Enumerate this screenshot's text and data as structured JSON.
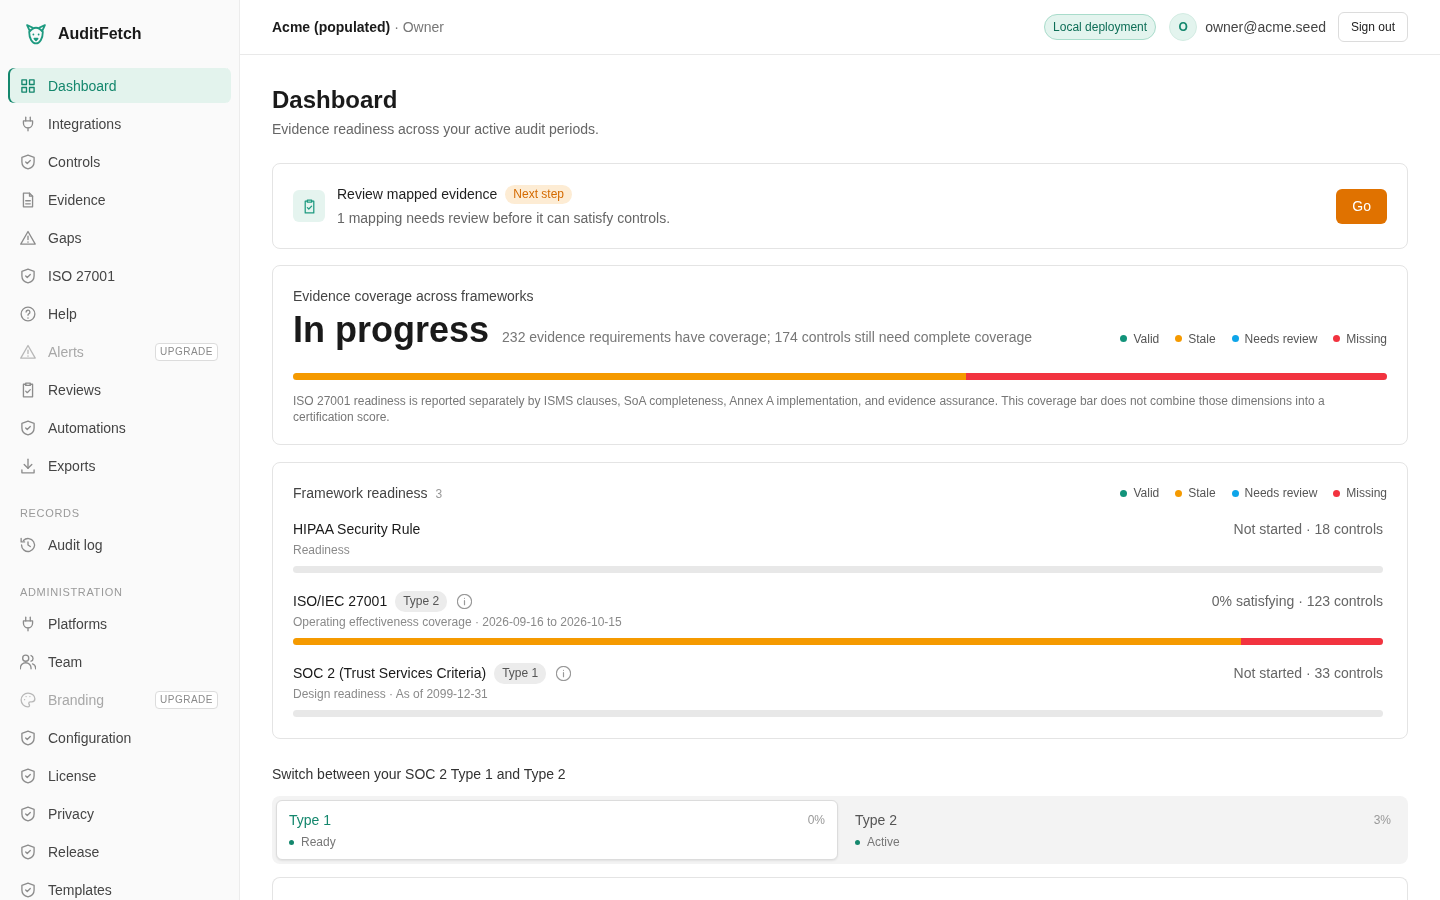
{
  "sidebar": {
    "brand": "AuditFetch",
    "sections": [
      {
        "items": [
          {
            "label": "Dashboard",
            "selected": true,
            "disabled": false
          },
          {
            "label": "Integrations",
            "selected": false,
            "disabled": false
          },
          {
            "label": "Controls",
            "selected": false,
            "disabled": false
          },
          {
            "label": "Evidence",
            "selected": false,
            "disabled": false
          },
          {
            "label": "Gaps",
            "selected": false,
            "disabled": false
          },
          {
            "label": "ISO 27001",
            "selected": false,
            "disabled": false
          },
          {
            "label": "Help",
            "selected": false,
            "disabled": false
          },
          {
            "label": "Alerts",
            "selected": false,
            "disabled": true,
            "badge": "UPGRADE"
          },
          {
            "label": "Reviews",
            "selected": false,
            "disabled": false
          },
          {
            "label": "Automations",
            "selected": false,
            "disabled": false
          },
          {
            "label": "Exports",
            "selected": false,
            "disabled": false
          }
        ]
      },
      {
        "label": "RECORDS",
        "items": [
          {
            "label": "Audit log",
            "selected": false,
            "disabled": false
          }
        ]
      },
      {
        "label": "ADMINISTRATION",
        "items": [
          {
            "label": "Platforms",
            "selected": false,
            "disabled": false
          },
          {
            "label": "Team",
            "selected": false,
            "disabled": false
          },
          {
            "label": "Branding",
            "selected": false,
            "disabled": true,
            "badge": "UPGRADE"
          },
          {
            "label": "Configuration",
            "selected": false,
            "disabled": false
          },
          {
            "label": "License",
            "selected": false,
            "disabled": false
          },
          {
            "label": "Privacy",
            "selected": false,
            "disabled": false
          },
          {
            "label": "Release",
            "selected": false,
            "disabled": false
          },
          {
            "label": "Templates",
            "selected": false,
            "disabled": false
          }
        ]
      }
    ]
  },
  "header": {
    "workspace": "Acme (populated)",
    "role": "· Owner",
    "deployment_badge": "Local deployment",
    "avatar_initial": "O",
    "email": "owner@acme.seed",
    "sign_out": "Sign out"
  },
  "page": {
    "title": "Dashboard",
    "subtitle": "Evidence readiness across your active audit periods."
  },
  "next_step": {
    "title": "Review mapped evidence",
    "badge": "Next step",
    "description": "1 mapping needs review before it can satisfy controls.",
    "button": "Go"
  },
  "coverage": {
    "heading": "Evidence coverage across frameworks",
    "status": "In progress",
    "summary": "232 evidence requirements have coverage; 174 controls still need complete coverage",
    "legend": [
      {
        "label": "Valid",
        "color": "#12937a"
      },
      {
        "label": "Stale",
        "color": "#f59a00"
      },
      {
        "label": "Needs review",
        "color": "#0ea5e9"
      },
      {
        "label": "Missing",
        "color": "#f2333f"
      }
    ],
    "bar": [
      {
        "color": "#f59a00",
        "level": 0.615
      },
      {
        "color": "#f2333f",
        "level": 0.385
      }
    ],
    "note": "ISO 27001 readiness is reported separately by ISMS clauses, SoA completeness, Annex A implementation, and evidence assurance. This coverage bar does not combine those dimensions into a certification score."
  },
  "frameworks": {
    "heading": "Framework readiness",
    "count": "3",
    "legend": [
      {
        "label": "Valid",
        "color": "#12937a"
      },
      {
        "label": "Stale",
        "color": "#f59a00"
      },
      {
        "label": "Needs review",
        "color": "#0ea5e9"
      },
      {
        "label": "Missing",
        "color": "#f2333f"
      }
    ],
    "items": [
      {
        "name": "HIPAA Security Rule",
        "info": false,
        "detail": "Readiness",
        "meta": "Not started · 18 controls"
      },
      {
        "name": "ISO/IEC 27001",
        "badge": "Type 2",
        "info": true,
        "detail": "Operating effectiveness coverage · 2026-09-16 to 2026-10-15",
        "meta": "0% satisfying · 123 controls",
        "bar": [
          {
            "color": "#f59a00",
            "level": 0.87
          },
          {
            "color": "#f2333f",
            "level": 0.13
          }
        ]
      },
      {
        "name": "SOC 2 (Trust Services Criteria)",
        "badge": "Type 1",
        "info": true,
        "detail": "Design readiness · As of 2099-12-31",
        "meta": "Not started · 33 controls"
      }
    ]
  },
  "soc2_switch": {
    "heading": "Switch between your SOC 2 Type 1 and Type 2",
    "options": [
      {
        "label": "Type 1",
        "percent": "0%",
        "status": "Ready",
        "selected": true
      },
      {
        "label": "Type 2",
        "percent": "3%",
        "status": "Active",
        "selected": false
      }
    ]
  }
}
